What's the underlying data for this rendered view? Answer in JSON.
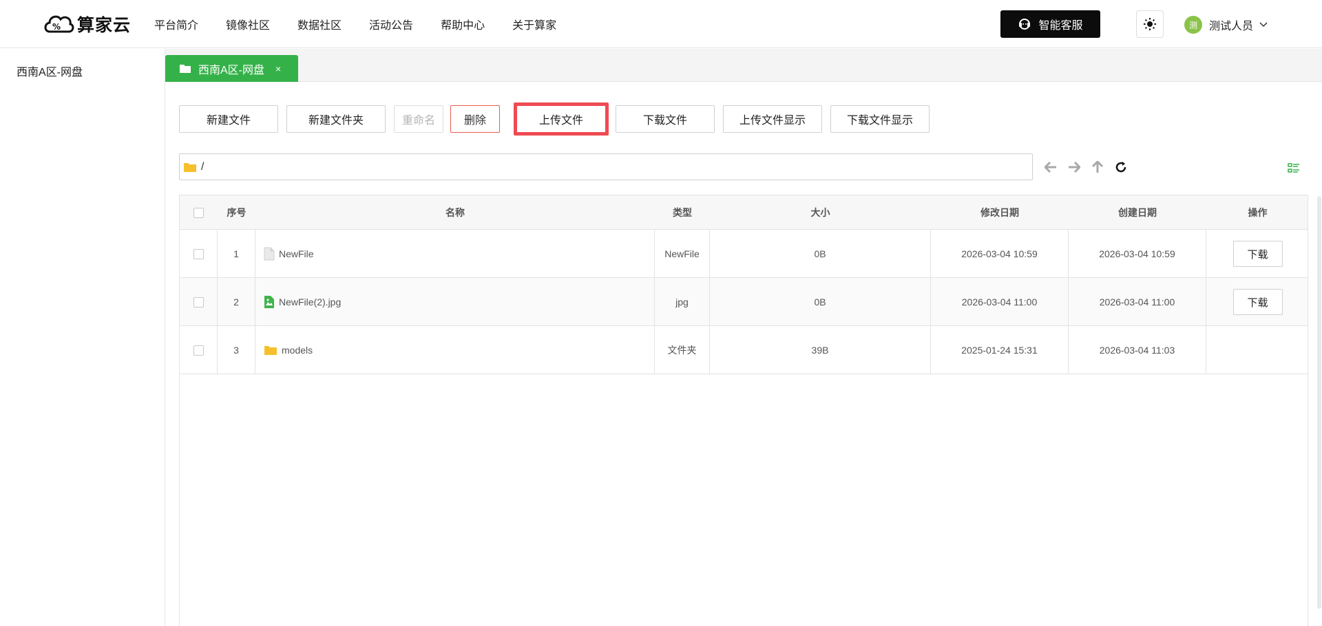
{
  "header": {
    "logo_text": "算家云",
    "nav": [
      "平台简介",
      "镜像社区",
      "数据社区",
      "活动公告",
      "帮助中心",
      "关于算家"
    ],
    "service_label": "智能客服",
    "user": {
      "avatar_text": "测",
      "name": "测试人员"
    },
    "colors": {
      "brand": "#0c0c0c",
      "avatar": "#8bc34a"
    }
  },
  "sidebar": {
    "items": [
      "西南A区-网盘"
    ]
  },
  "tabs": [
    {
      "label": "西南A区-网盘",
      "close": "×"
    }
  ],
  "toolbar": {
    "new_file": "新建文件",
    "new_folder": "新建文件夹",
    "rename": "重命名",
    "delete": "删除",
    "upload": "上传文件",
    "download": "下载文件",
    "upload_display": "上传文件显示",
    "download_display": "下载文件显示"
  },
  "path": {
    "value": "/"
  },
  "table": {
    "headers": [
      "序号",
      "名称",
      "类型",
      "大小",
      "修改日期",
      "创建日期",
      "操作"
    ],
    "rows": [
      {
        "index": "1",
        "icon": "file-icon",
        "name": "NewFile",
        "type": "NewFile",
        "size": "0B",
        "modified": "2026-03-04 10:59",
        "created": "2026-03-04 10:59",
        "action": "下载"
      },
      {
        "index": "2",
        "icon": "image-file-icon",
        "name": "NewFile(2).jpg",
        "type": "jpg",
        "size": "0B",
        "modified": "2026-03-04 11:00",
        "created": "2026-03-04 11:00",
        "action": "下载"
      },
      {
        "index": "3",
        "icon": "folder-icon",
        "name": "models",
        "type": "文件夹",
        "size": "39B",
        "modified": "2025-01-24 15:31",
        "created": "2026-03-04 11:03",
        "action": ""
      }
    ]
  },
  "colors": {
    "accent": "#34b249",
    "highlight": "#f04a52",
    "danger": "#e85a4f",
    "folder": "#f6c02c"
  }
}
